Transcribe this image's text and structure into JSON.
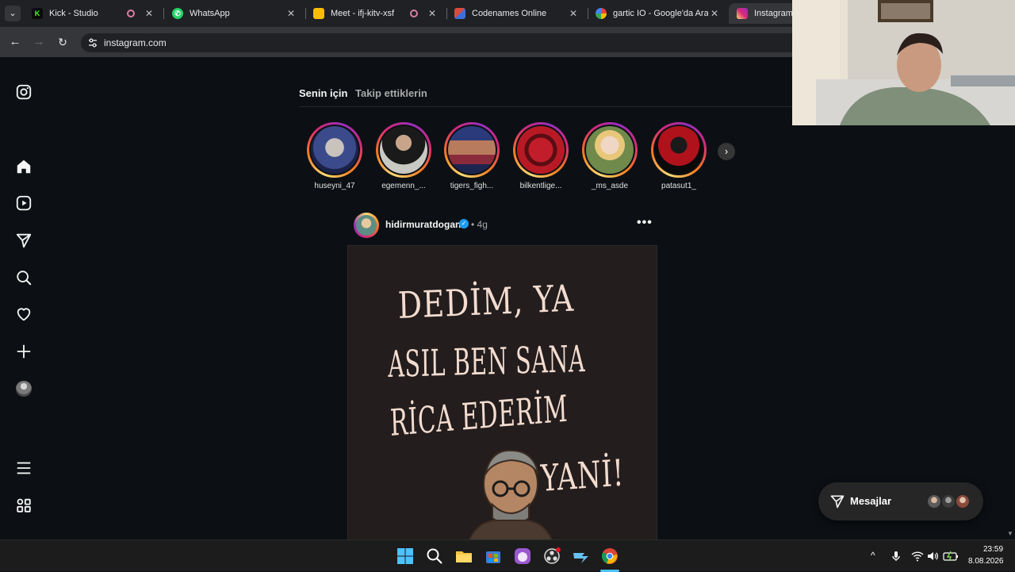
{
  "browser": {
    "tabs": [
      {
        "title": "Kick - Studio",
        "icon": "kick-icon",
        "recording": true
      },
      {
        "title": "WhatsApp",
        "icon": "whatsapp-icon",
        "recording": false
      },
      {
        "title": "Meet - ifj-kitv-xsf",
        "icon": "google-meet-icon",
        "recording": true
      },
      {
        "title": "Codenames Online",
        "icon": "codenames-icon",
        "recording": false
      },
      {
        "title": "gartic IO - Google'da Ara",
        "icon": "google-icon",
        "recording": false
      },
      {
        "title": "Instagram",
        "icon": "instagram-icon",
        "recording": false,
        "active": true
      }
    ],
    "tab_menu_glyph": "⌄",
    "close_glyph": "✕",
    "url": "instagram.com"
  },
  "instagram": {
    "feed_tabs": {
      "for_you": "Senin için",
      "following": "Takip ettiklerin"
    },
    "stories": [
      {
        "username": "huseyni_47"
      },
      {
        "username": "egemenn_..."
      },
      {
        "username": "tigers_figh..."
      },
      {
        "username": "bilkentlige..."
      },
      {
        "username": "_ms_asde"
      },
      {
        "username": "patasut1_"
      }
    ],
    "post": {
      "username": "hidirmuratdogan",
      "verified": true,
      "separator": "•",
      "time": "4g",
      "more_glyph": "•••",
      "image_text": [
        "DEDİM, YA",
        "ASIL BEN SANA",
        "RİCA EDERİM",
        "YANİ!"
      ]
    },
    "messages": {
      "label": "Mesajlar"
    }
  },
  "taskbar": {
    "time": "23:59",
    "date": "8.08.2026",
    "tray_chevron": "^"
  },
  "colors": {
    "ig_background": "#0c1014",
    "story_ring_yellow": "#feda75",
    "story_ring_pink": "#d62976",
    "verified_blue": "#1d9bf0",
    "browser_dark": "#202124"
  }
}
